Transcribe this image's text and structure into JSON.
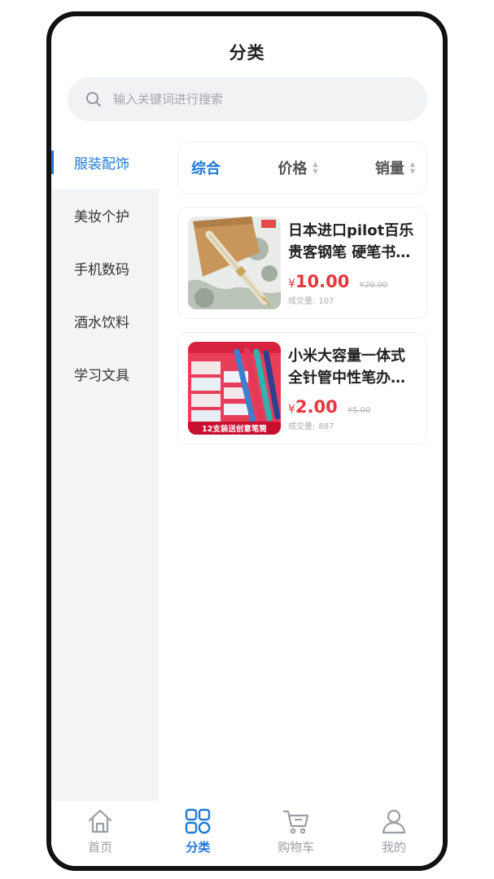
{
  "header": {
    "title": "分类"
  },
  "search": {
    "placeholder": "输入关键词进行搜索",
    "icon": "search-icon"
  },
  "sidebar": {
    "items": [
      {
        "label": "服装配饰",
        "active": true
      },
      {
        "label": "美妆个护",
        "active": false
      },
      {
        "label": "手机数码",
        "active": false
      },
      {
        "label": "酒水饮料",
        "active": false
      },
      {
        "label": "学习文具",
        "active": false
      }
    ]
  },
  "sort": {
    "items": [
      {
        "label": "综合",
        "active": true
      },
      {
        "label": "价格",
        "active": false
      },
      {
        "label": "销量",
        "active": false
      }
    ]
  },
  "products": [
    {
      "name": "日本进口pilot百乐贵客钢笔 硬笔书法练字笔",
      "currency": "¥",
      "price": "10.00",
      "old_price": "¥20.00",
      "sales_label": "成交量:",
      "sales": "107"
    },
    {
      "name": "小米大容量一体式全针管中性笔办公签字笔",
      "currency": "¥",
      "price": "2.00",
      "old_price": "¥5.00",
      "sales_label": "成交量:",
      "sales": "887",
      "banner": "12支装送创意笔筒"
    }
  ],
  "tabbar": {
    "items": [
      {
        "label": "首页",
        "icon": "home-icon",
        "active": false
      },
      {
        "label": "分类",
        "icon": "category-icon",
        "active": true
      },
      {
        "label": "购物车",
        "icon": "cart-icon",
        "active": false
      },
      {
        "label": "我的",
        "icon": "user-icon",
        "active": false
      }
    ]
  },
  "colors": {
    "accent": "#1f7ad6",
    "price": "#e8363c"
  }
}
